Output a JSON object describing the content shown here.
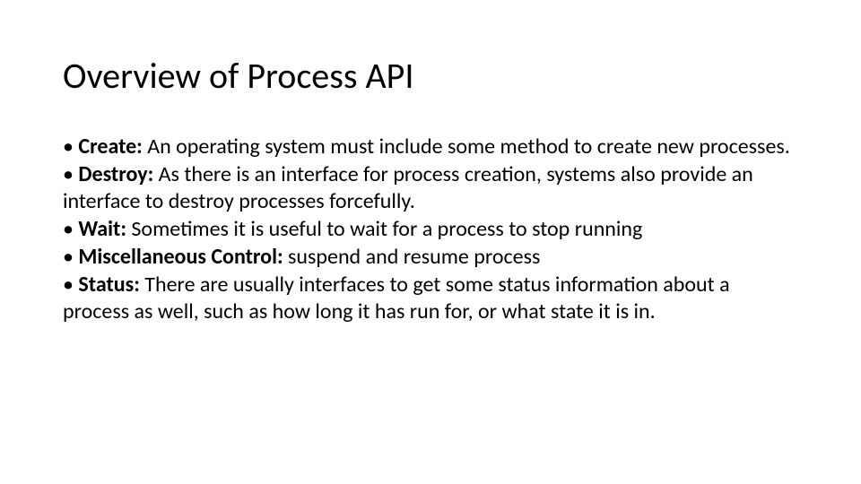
{
  "slide": {
    "title": "Overview of Process API",
    "items": [
      {
        "term": "Create:",
        "text": " An operating system must include some method to create new processes."
      },
      {
        "term": "Destroy:",
        "text": " As there is an interface for process creation, systems also provide an interface to destroy processes forcefully."
      },
      {
        "term": "Wait:",
        "text": " Sometimes it is useful to wait for a process to stop running"
      },
      {
        "term": "Miscellaneous Control:",
        "text": " suspend and resume process"
      },
      {
        "term": "Status:",
        "text": " There are usually interfaces to get some status information about a process as well, such as how long it has run for, or what state it is in."
      }
    ]
  }
}
